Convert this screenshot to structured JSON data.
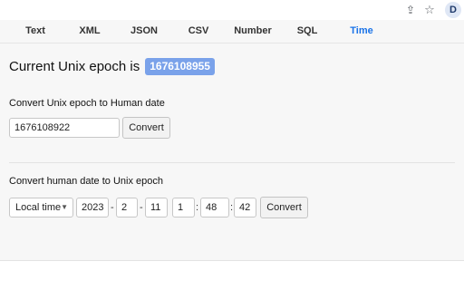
{
  "browser": {
    "share_icon": "share-icon",
    "star_icon": "star-icon",
    "profile_initial": "D"
  },
  "nav": {
    "tabs": [
      {
        "label": "Text"
      },
      {
        "label": "XML"
      },
      {
        "label": "JSON"
      },
      {
        "label": "CSV"
      },
      {
        "label": "Number"
      },
      {
        "label": "SQL"
      },
      {
        "label": "Time",
        "active": true
      }
    ]
  },
  "current_epoch": {
    "label": "Current Unix epoch is",
    "value": "1676108955"
  },
  "epoch_to_human": {
    "heading": "Convert Unix epoch to Human date",
    "input_value": "1676108922",
    "button_label": "Convert"
  },
  "human_to_epoch": {
    "heading": "Convert human date to Unix epoch",
    "timezone": "Local time",
    "year": "2023",
    "month": "2",
    "day": "11",
    "hour": "1",
    "minute": "48",
    "second": "42",
    "date_separator": "-",
    "time_separator": ":",
    "button_label": "Convert"
  },
  "colors": {
    "accent": "#1a73e8",
    "badge": "#7aa2ea",
    "panel": "#f7f7f7"
  }
}
